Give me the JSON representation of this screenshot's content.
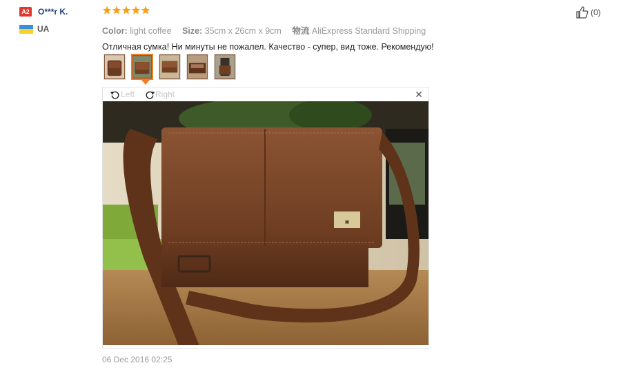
{
  "reviewer": {
    "level_badge": "A2",
    "name": "O***r K.",
    "country": "UA"
  },
  "review": {
    "rating": 5,
    "meta": {
      "color_label": "Color:",
      "color_value": "light coffee",
      "size_label": "Size:",
      "size_value": "35cm x 26cm x 9cm",
      "shipping_label": "物流",
      "shipping_value": "AliExpress Standard Shipping"
    },
    "text": "Отличная сумка! Ни минуты не пожалел. Качество - супер, вид тоже. Рекомендую!",
    "date": "06 Dec 2016 02:25"
  },
  "thumbnails": {
    "count": 5,
    "active_index": 1
  },
  "viewer": {
    "rotate_left_label": "Left",
    "rotate_right_label": "Right",
    "close_symbol": "✕"
  },
  "helpful": {
    "count": "(0)"
  },
  "colors": {
    "accent": "#f07e22",
    "star": "#f7a11b",
    "username": "#1f3f7a",
    "badge": "#e0382f"
  },
  "icons": {
    "rotate_left": "rotate-left-icon",
    "rotate_right": "rotate-right-icon",
    "close": "close-icon",
    "thumbs_up": "thumbs-up-icon",
    "star": "star-icon"
  }
}
